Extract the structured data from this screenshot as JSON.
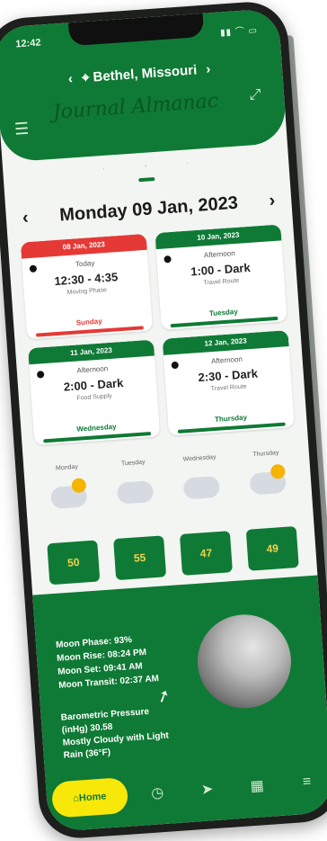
{
  "status": {
    "time": "12:42",
    "icons": "▮▮ ⌒ ▭"
  },
  "header": {
    "location_prev_icon": "chevron-left",
    "location_label": "Bethel, Missouri",
    "location_next_icon": "chevron-right",
    "title": "Journal Almanac"
  },
  "date_nav": {
    "prev": "‹",
    "date": "Monday 09 Jan, 2023",
    "next": "›"
  },
  "cards": [
    {
      "date": "08 Jan, 2023",
      "period": "Today",
      "range": "12:30 - 4:35",
      "sub": "Moving Phase",
      "day": "Sunday",
      "header_color": "#e53935",
      "footer_color": "#e53935"
    },
    {
      "date": "10 Jan, 2023",
      "period": "Afternoon",
      "range": "1:00 - Dark",
      "sub": "Travel Route",
      "day": "Tuesday",
      "header_color": "#0f7a35",
      "footer_color": "#0f7a35"
    },
    {
      "date": "11 Jan, 2023",
      "period": "Afternoon",
      "range": "2:00 - Dark",
      "sub": "Food Supply",
      "day": "Wednesday",
      "header_color": "#0f7a35",
      "footer_color": "#0f7a35"
    },
    {
      "date": "12 Jan, 2023",
      "period": "Afternoon",
      "range": "2:30 - Dark",
      "sub": "Travel Route",
      "day": "Thursday",
      "header_color": "#0f7a35",
      "footer_color": "#0f7a35"
    }
  ],
  "weather": [
    {
      "label": "Monday",
      "temp": "50"
    },
    {
      "label": "Tuesday",
      "temp": "55"
    },
    {
      "label": "Wednesday",
      "temp": "47"
    },
    {
      "label": "Thursday",
      "temp": "49"
    }
  ],
  "moon": {
    "phase": "Moon Phase: 93%",
    "rise": "Moon Rise: 08:24 PM",
    "set": "Moon Set: 09:41 AM",
    "transit": "Moon Transit: 02:37 AM",
    "pressure": "Barometric Pressure (inHg) 30.58",
    "condition": "Mostly Cloudy with Light Rain (36°F)"
  },
  "bottom_nav": {
    "home": "Home"
  },
  "colors": {
    "primary": "#0f7a35",
    "accent": "#f7e80a",
    "alert": "#e53935"
  }
}
